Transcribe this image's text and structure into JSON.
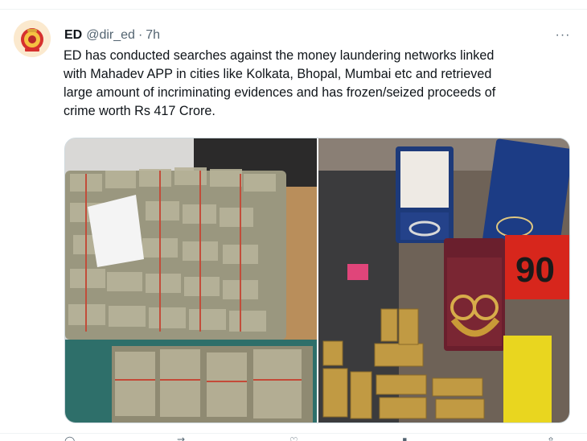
{
  "tweet": {
    "author_name": "ED",
    "handle": "@dir_ed",
    "separator": "·",
    "time": "7h",
    "more": "···",
    "text_lines": [
      "ED has conducted searches against the money laundering networks linked",
      "with Mahadev APP in cities like Kolkata, Bhopal, Mumbai etc and retrieved",
      "large amount of incriminating evidences and has frozen/seized proceeds of",
      "crime worth Rs 417 Crore."
    ],
    "media": [
      {
        "name": "photo-cash-bundles"
      },
      {
        "name": "photo-gold-jewellery"
      }
    ]
  },
  "icons": [
    "avatar-emblem",
    "more-options-icon",
    "reply-icon",
    "retweet-icon",
    "like-icon",
    "views-icon",
    "share-icon"
  ],
  "colors": {
    "text": "#0f1419",
    "secondary": "#536471",
    "border": "#cfd9de"
  }
}
